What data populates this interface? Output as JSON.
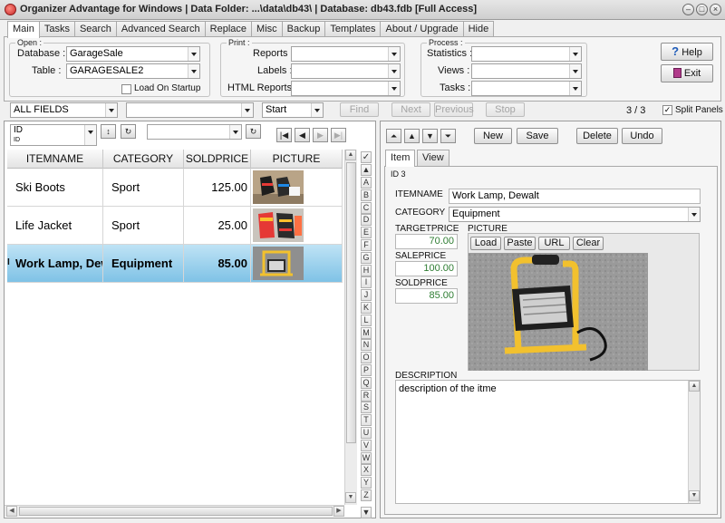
{
  "window": {
    "title": "Organizer Advantage for Windows | Data Folder: ...\\data\\db43\\ | Database: db43.fdb [Full Access]",
    "min_glyph": "–",
    "max_glyph": "□",
    "close_glyph": "×"
  },
  "tabs": [
    "Main",
    "Tasks",
    "Search",
    "Advanced Search",
    "Replace",
    "Misc",
    "Backup",
    "Templates",
    "About / Upgrade",
    "Hide"
  ],
  "open_group": {
    "legend": "Open :",
    "database_label": "Database :",
    "database_value": "GarageSale",
    "table_label": "Table :",
    "table_value": "GARAGESALE2",
    "load_on_startup": "Load On Startup"
  },
  "print_group": {
    "legend": "Print :",
    "reports_label": "Reports :",
    "labels_label": "Labels :",
    "html_reports_label": "HTML Reports :"
  },
  "process_group": {
    "legend": "Process :",
    "statistics_label": "Statistics :",
    "views_label": "Views :",
    "tasks_label": "Tasks :"
  },
  "buttons": {
    "help": "Help",
    "exit": "Exit"
  },
  "search_bar": {
    "field_value": "ALL FIELDS",
    "search_value": "",
    "mode_value": "Start",
    "find": "Find",
    "next": "Next",
    "previous": "Previous",
    "stop": "Stop",
    "record_counter": "3 / 3",
    "split_panels": "Split Panels"
  },
  "sort_bar": {
    "sort_field_value": "ID",
    "sort_field_sub": "ID",
    "sort_glyph": "↕",
    "refresh_glyph": "↻",
    "filter_value": "",
    "nav_glyphs": [
      "|◀",
      "◀",
      "▶",
      "▶|"
    ]
  },
  "grid": {
    "columns": [
      "ITEMNAME",
      "CATEGORY",
      "SOLDPRICE",
      "PICTURE"
    ],
    "rows": [
      {
        "itemname": "Ski Boots",
        "category": "Sport",
        "soldprice": "125.00",
        "picture": "ski-boots-photo",
        "selected": false
      },
      {
        "itemname": "Life Jacket",
        "category": "Sport",
        "soldprice": "25.00",
        "picture": "life-jacket-photo",
        "selected": false
      },
      {
        "itemname": "Work Lamp, Dewalt",
        "category": "Equipment",
        "soldprice": "85.00",
        "picture": "work-lamp-photo",
        "selected": true
      }
    ],
    "row_indicator": "I",
    "check_glyph": "✓"
  },
  "alphabet": [
    "A",
    "B",
    "C",
    "D",
    "E",
    "F",
    "G",
    "H",
    "I",
    "J",
    "K",
    "L",
    "M",
    "N",
    "O",
    "P",
    "Q",
    "R",
    "S",
    "T",
    "U",
    "V",
    "W",
    "X",
    "Y",
    "Z"
  ],
  "record_toolbar": {
    "move_glyphs": [
      "⏶",
      "▲",
      "▼",
      "⏷"
    ],
    "new": "New",
    "save": "Save",
    "delete": "Delete",
    "undo": "Undo"
  },
  "detail_tabs": [
    "Item",
    "View"
  ],
  "detail": {
    "id_label": "ID 3",
    "itemname_label": "ITEMNAME",
    "itemname_value": "Work Lamp, Dewalt",
    "category_label": "CATEGORY",
    "category_value": "Equipment",
    "targetprice_label": "TARGETPRICE",
    "targetprice_value": "70.00",
    "saleprice_label": "SALEPRICE",
    "saleprice_value": "100.00",
    "soldprice_label": "SOLDPRICE",
    "soldprice_value": "85.00",
    "picture_label": "PICTURE",
    "picture_buttons": [
      "Load",
      "Paste",
      "URL",
      "Clear"
    ],
    "description_label": "DESCRIPTION",
    "description_value": "description of the itme"
  },
  "colors": {
    "selected_row_top": "#bfe3f5",
    "selected_row_bottom": "#7fc2e6",
    "price_green": "#2e7d32",
    "help_icon": "#1e5bb8",
    "exit_icon": "#b03a8a"
  }
}
